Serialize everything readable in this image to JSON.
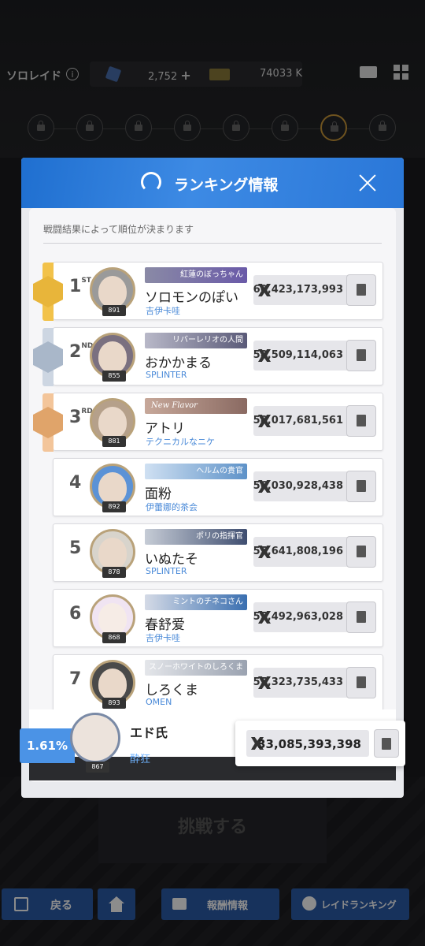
{
  "header": {
    "mode_title": "ソロレイド",
    "gems": "2,752",
    "gems_plus": "+",
    "tickets": "74033 K"
  },
  "modal": {
    "title": "ランキング情報",
    "subtitle": "戦闘結果によって順位が決まります"
  },
  "rankings": [
    {
      "rank": "1",
      "suffix": "ST",
      "title": "紅蓮のぼっちゃん",
      "name": "ソロモンのぽい",
      "guild": "吉伊卡哇",
      "score": "60,423,173,993",
      "level": "891"
    },
    {
      "rank": "2",
      "suffix": "ND",
      "title": "リバーレリオの人間",
      "name": "おかかまる",
      "guild": "SPLINTER",
      "score": "58,509,114,063",
      "level": "855"
    },
    {
      "rank": "3",
      "suffix": "RD",
      "title": "New Flavor",
      "name": "アトリ",
      "guild": "テクニカルなニケ",
      "score": "58,017,681,561",
      "level": "881"
    },
    {
      "rank": "4",
      "suffix": "",
      "title": "ヘルムの貴官",
      "name": "面粉",
      "guild": "伊蕾娜的茶会",
      "score": "56,030,928,438",
      "level": "892"
    },
    {
      "rank": "5",
      "suffix": "",
      "title": "ポリの指揮官",
      "name": "いぬたそ",
      "guild": "SPLINTER",
      "score": "55,641,808,196",
      "level": "878"
    },
    {
      "rank": "6",
      "suffix": "",
      "title": "ミントのチネコさん",
      "name": "春舒爱",
      "guild": "吉伊卡哇",
      "score": "55,492,963,028",
      "level": "868"
    },
    {
      "rank": "7",
      "suffix": "",
      "title": "スノーホワイトのしろくま",
      "name": "しろくま",
      "guild": "OMEN",
      "score": "55,323,735,433",
      "level": "893"
    }
  ],
  "my_rank": {
    "percentile": "1.61%",
    "name": "エド氏",
    "guild": "酔狂",
    "score": "33,085,393,398",
    "level": "867"
  },
  "bottom": {
    "challenge": "挑戦する",
    "back": "戻る",
    "reward": "報酬情報",
    "raid_ranking": "レイドランキング"
  },
  "colors": {
    "header_blue": "#2a77d8",
    "gold": "#e8b53a",
    "silver": "#a9b7c9",
    "bronze": "#e0a46a",
    "button_blue": "#2b5ba8"
  }
}
